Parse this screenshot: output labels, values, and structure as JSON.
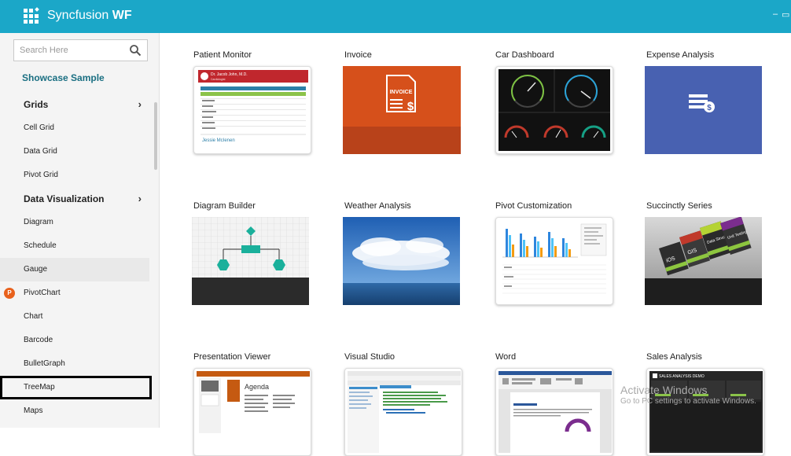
{
  "app": {
    "title_prefix": "Syncfusion",
    "title_suffix": "WF",
    "minimize_glyph": "–",
    "maximize_glyph": "▭"
  },
  "search": {
    "placeholder": "Search Here"
  },
  "sidebar": {
    "header": "Showcase Sample",
    "items": [
      {
        "label": "Grids",
        "group": true
      },
      {
        "label": "Cell Grid"
      },
      {
        "label": "Data Grid"
      },
      {
        "label": "Pivot Grid"
      },
      {
        "label": "Data Visualization",
        "group": true
      },
      {
        "label": "Diagram"
      },
      {
        "label": "Schedule"
      },
      {
        "label": "Gauge"
      },
      {
        "label": "PivotChart",
        "badge": "P"
      },
      {
        "label": "Chart"
      },
      {
        "label": "Barcode"
      },
      {
        "label": "BulletGraph"
      },
      {
        "label": "TreeMap"
      },
      {
        "label": "Maps"
      }
    ]
  },
  "samples": [
    {
      "title": "Patient Monitor",
      "thumb_text": [
        "Dr. Jacob John, M.D.",
        "Cardiologist",
        "Jessie McIenen"
      ]
    },
    {
      "title": "Invoice",
      "thumb_text": [
        "INVOICE",
        "$"
      ]
    },
    {
      "title": "Car Dashboard"
    },
    {
      "title": "Expense Analysis"
    },
    {
      "title": "Diagram Builder"
    },
    {
      "title": "Weather Analysis"
    },
    {
      "title": "Pivot Customization"
    },
    {
      "title": "Succinctly Series",
      "thumb_text": [
        "iOS",
        "GIS",
        "Data Structures",
        "Unit Testing"
      ]
    },
    {
      "title": "Presentation Viewer",
      "thumb_text": [
        "Agenda"
      ]
    },
    {
      "title": "Visual Studio"
    },
    {
      "title": "Word"
    },
    {
      "title": "Sales Analysis",
      "thumb_text": [
        "SALES ANALYSIS DEMO"
      ]
    }
  ],
  "watermark": {
    "line1": "Activate Windows",
    "line2": "Go to PC settings to activate Windows."
  },
  "colors": {
    "titlebar": "#1ba7c8",
    "accent_text": "#1a6f82",
    "invoice": "#d6501b",
    "expense": "#4861b1",
    "badge": "#e8611c"
  }
}
